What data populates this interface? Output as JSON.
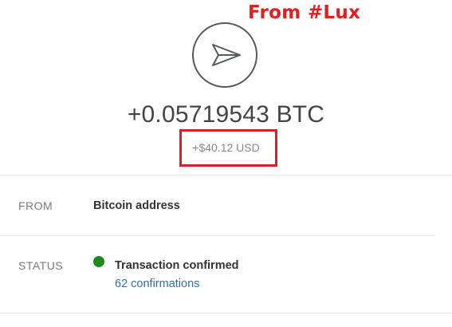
{
  "annotation": {
    "text": "From #Lux",
    "color": "#e0201f"
  },
  "transaction": {
    "icon": "send-paper-plane-icon",
    "amount_btc": "+0.05719543 BTC",
    "amount_usd": "+$40.12 USD"
  },
  "details": {
    "from_label": "FROM",
    "from_value": "Bitcoin address",
    "status_label": "STATUS",
    "status_value": "Transaction confirmed",
    "status_color": "#1d8a1d",
    "confirmations": "62 confirmations"
  },
  "colors": {
    "link": "#2b6fb6",
    "highlight_box": "#d9202a"
  }
}
